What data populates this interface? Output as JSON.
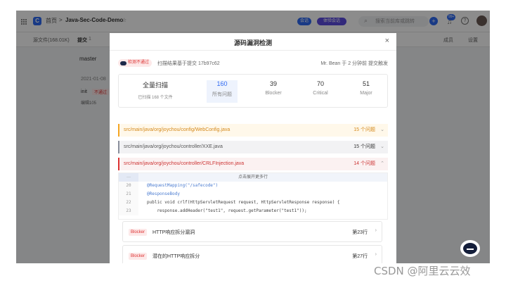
{
  "topbar": {
    "home": "首页",
    "separator": ">",
    "repo": "Java-Sec-Code-Demo",
    "pill_1": "会话",
    "pill_2": "体验会话",
    "search_placeholder": "搜索当前库或跳转",
    "badge_count": "99+"
  },
  "tabs": {
    "files": "源文件(168.01K)",
    "commits": "提交",
    "commits_count": "1",
    "members": "成员",
    "settings": "设置"
  },
  "bg": {
    "branch": "master",
    "date": "2021-01-08",
    "init": "init",
    "fail": "不通过",
    "author": "编辑105"
  },
  "modal": {
    "title": "源码漏洞检测",
    "close": "×",
    "fail_badge": "检测不通过",
    "scan_info": "扫描结果基于提交 17b97c62",
    "trigger_info": "Mr. Bean 于 2 分钟前 提交触发",
    "full_scan": "全量扫描",
    "scanned_files": "已扫描 168 个文件",
    "stats": [
      {
        "value": "160",
        "label": "所有问题"
      },
      {
        "value": "39",
        "label": "Blocker"
      },
      {
        "value": "70",
        "label": "Critical"
      },
      {
        "value": "51",
        "label": "Major"
      }
    ],
    "files": [
      {
        "path": "src/main/java/org/joychou/config/WebConfig.java",
        "count": "15 个问题",
        "chev": "⌄"
      },
      {
        "path": "src/main/java/org/joychou/controller/XXE.java",
        "count": "15 个问题",
        "chev": "⌄"
      },
      {
        "path": "src/main/java/org/joychou/controller/CRLFInjection.java",
        "count": "14 个问题",
        "chev": "⌃"
      }
    ],
    "expand_dots": "···",
    "expand_text": "点击展开更多行",
    "code": [
      {
        "num": "20",
        "text": "@RequestMapping(\"/safecode\")"
      },
      {
        "num": "21",
        "text": "@ResponseBody"
      },
      {
        "num": "22",
        "text": "public void crlf(HttpServletRequest request, HttpServletResponse response) {"
      },
      {
        "num": "23",
        "text": "    response.addHeader(\"test1\", request.getParameter(\"test1\"));"
      }
    ],
    "issues": [
      {
        "tag": "Blocker",
        "title": "HTTP响应拆分漏洞",
        "line": "第23行",
        "chev": "›"
      },
      {
        "tag": "Blocker",
        "title": "潜在的HTTP响应拆分",
        "line": "第27行",
        "chev": "›"
      }
    ]
  },
  "watermark": "CSDN @阿里云云效",
  "colors": {
    "accent": "#2f6af2",
    "warning": "#f5a623",
    "danger": "#d33333",
    "overlay": "rgba(0,0,0,0.45)"
  }
}
